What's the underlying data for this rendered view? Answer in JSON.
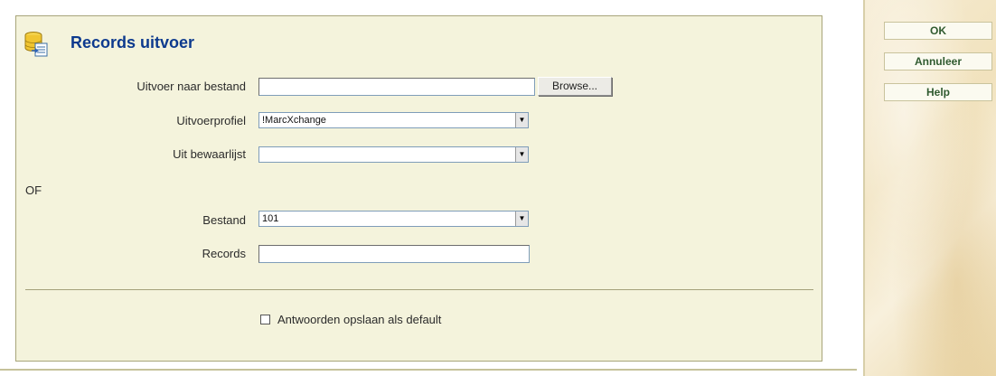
{
  "panel": {
    "title": "Records uitvoer",
    "icon": "database-export-icon"
  },
  "form": {
    "output_file_label": "Uitvoer naar bestand",
    "output_file_value": "",
    "browse_label": "Browse...",
    "profile_label": "Uitvoerprofiel",
    "profile_value": "!MarcXchange",
    "savelist_label": "Uit bewaarlijst",
    "savelist_value": "",
    "or_label": "OF",
    "file_label": "Bestand",
    "file_value": "101",
    "records_label": "Records",
    "records_value": "",
    "save_default_label": "Antwoorden opslaan als default",
    "save_default_checked": false
  },
  "side_buttons": {
    "ok": "OK",
    "cancel": "Annuleer",
    "help": "Help"
  }
}
